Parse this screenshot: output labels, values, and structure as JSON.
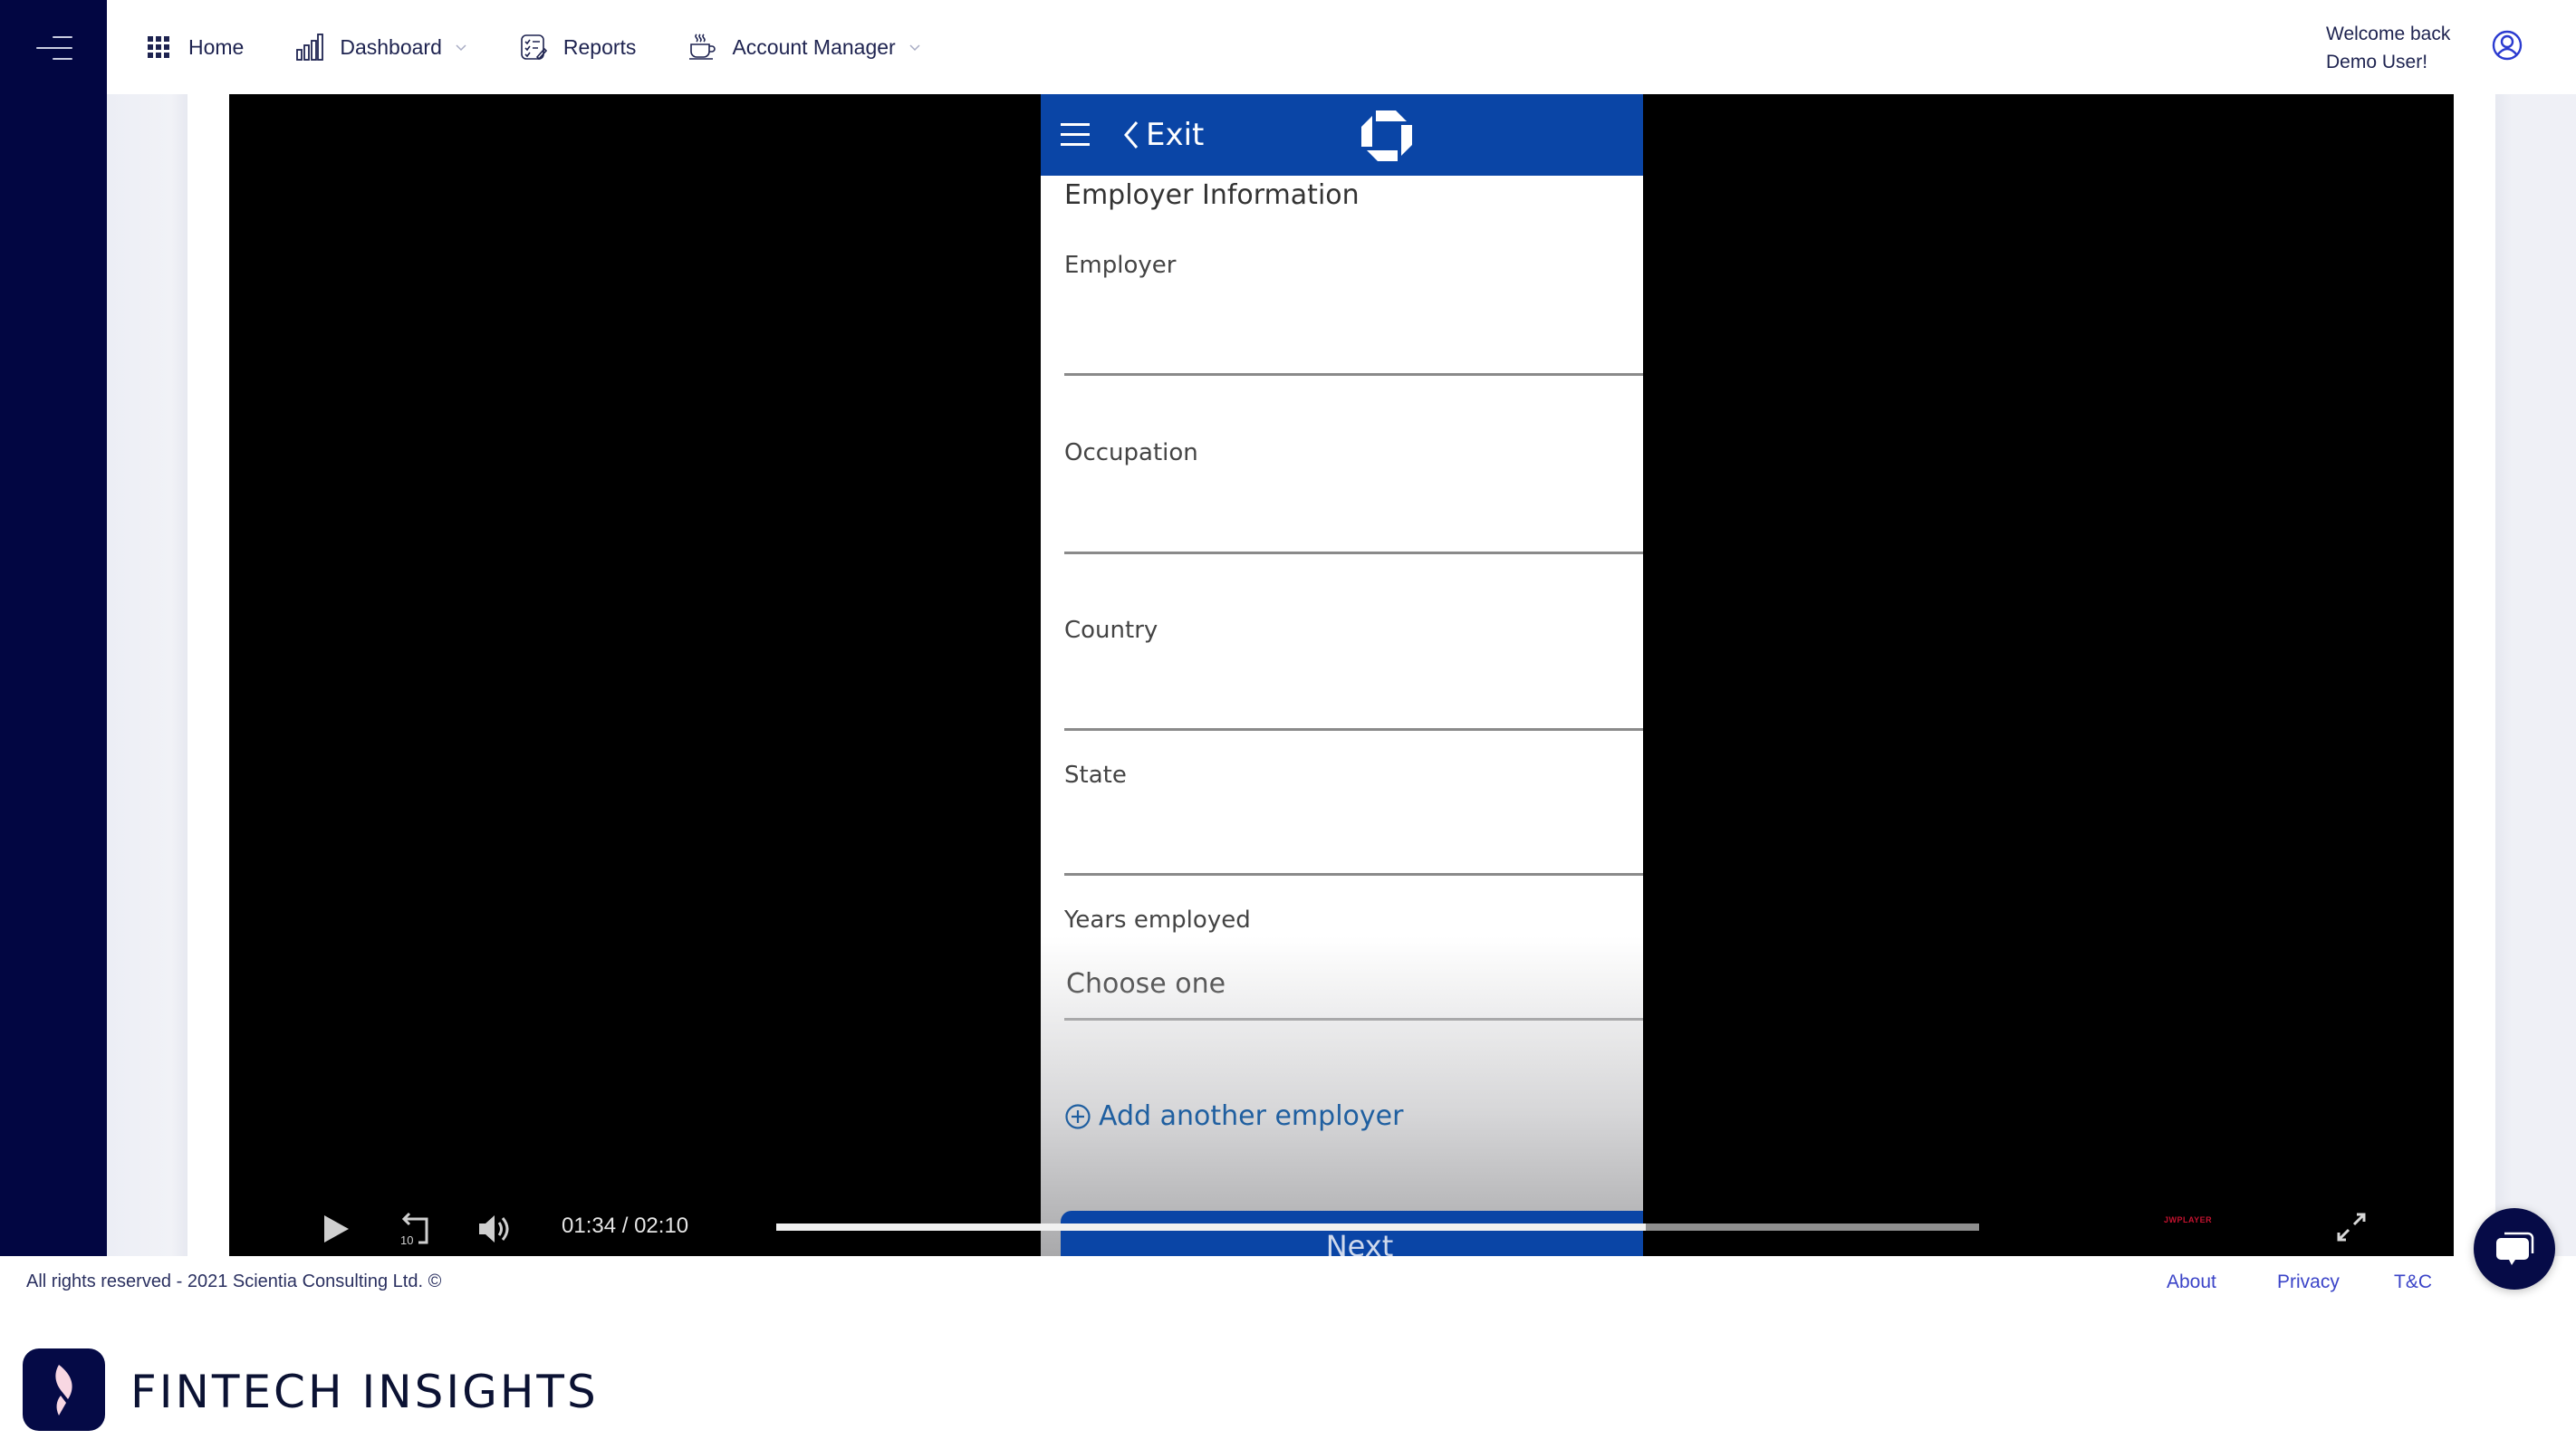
{
  "sidebar": {
    "toggle_icon": "hamburger-menu-icon"
  },
  "header": {
    "nav": [
      {
        "label": "Home",
        "icon": "grid-icon",
        "has_dropdown": false
      },
      {
        "label": "Dashboard",
        "icon": "bar-chart-icon",
        "has_dropdown": true
      },
      {
        "label": "Reports",
        "icon": "checklist-icon",
        "has_dropdown": false
      },
      {
        "label": "Account Manager",
        "icon": "coffee-cup-icon",
        "has_dropdown": true
      }
    ],
    "welcome_line1": "Welcome back",
    "welcome_line2": "Demo User!",
    "user_icon": "user-circle-icon"
  },
  "video": {
    "phone": {
      "exit_label": "Exit",
      "section_title": "Employer Information",
      "fields": [
        {
          "label": "Employer",
          "value": ""
        },
        {
          "label": "Occupation",
          "value": ""
        },
        {
          "label": "Country",
          "value": ""
        },
        {
          "label": "State",
          "value": ""
        },
        {
          "label": "Years employed",
          "value": "Choose one"
        }
      ],
      "add_employer_label": "Add another employer",
      "next_label": "Next",
      "bank_color": "#0a45a6"
    },
    "controls": {
      "current_time": "01:34",
      "separator": " / ",
      "duration": "02:10",
      "progress_fraction": 0.723,
      "player_brand": "JWPLAYER"
    }
  },
  "footer": {
    "copyright": "All rights reserved - 2021 Scientia Consulting Ltd. ©",
    "links": [
      "About",
      "Privacy",
      "T&C"
    ],
    "brand_name": "FINTECH INSIGHTS"
  },
  "colors": {
    "sidebar": "#020642",
    "nav_text": "#1e2350",
    "link": "#3b44c8"
  }
}
